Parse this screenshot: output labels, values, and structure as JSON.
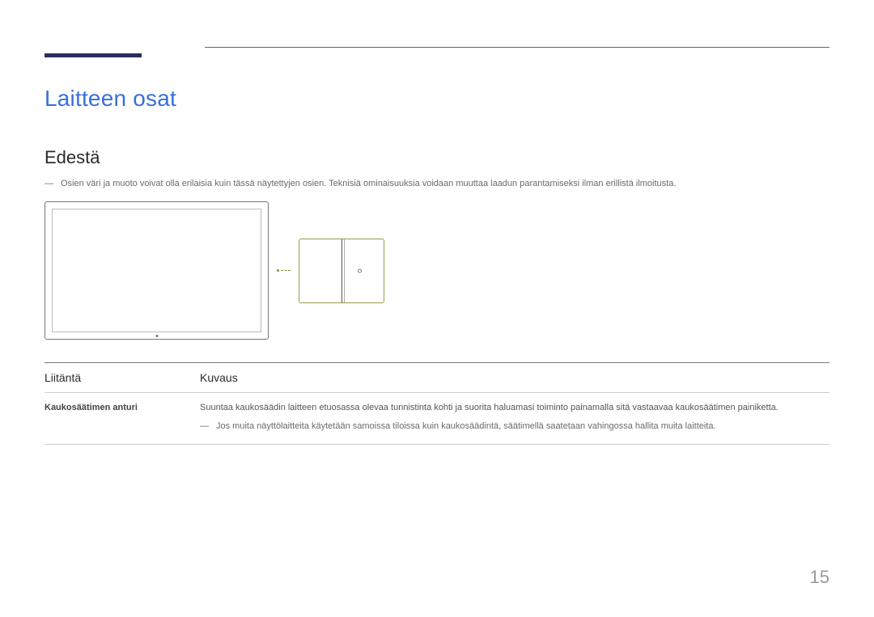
{
  "headings": {
    "main": "Laitteen osat",
    "sub": "Edestä"
  },
  "notes": {
    "top": "Osien väri ja muoto voivat olla erilaisia kuin tässä näytettyjen osien. Teknisiä ominaisuuksia voidaan muuttaa laadun parantamiseksi ilman erillistä ilmoitusta."
  },
  "table": {
    "headers": {
      "port": "Liitäntä",
      "desc": "Kuvaus"
    },
    "rows": [
      {
        "port": "Kaukosäätimen anturi",
        "desc": "Suuntaa kaukosäädin laitteen etuosassa olevaa tunnistinta kohti ja suorita haluamasi toiminto painamalla sitä vastaavaa kaukosäätimen painiketta.",
        "note": "Jos muita näyttölaitteita käytetään samoissa tiloissa kuin kaukosäädintä, säätimellä saatetaan vahingossa hallita muita laitteita."
      }
    ]
  },
  "page_number": "15"
}
